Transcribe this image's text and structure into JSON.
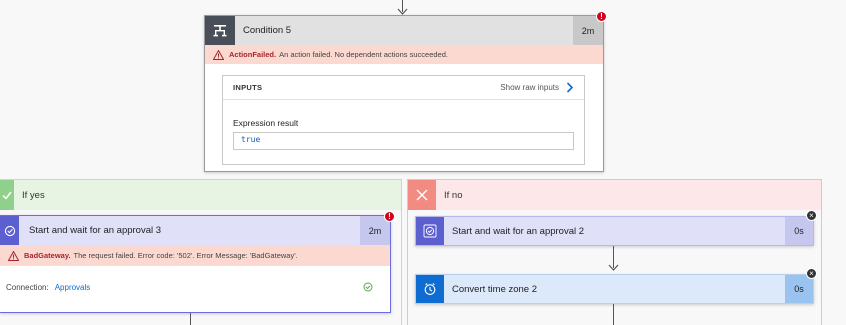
{
  "condition": {
    "title": "Condition 5",
    "duration": "2m",
    "error_code": "ActionFailed.",
    "error_message": "An action failed. No dependent actions succeeded.",
    "inputs_label": "INPUTS",
    "show_raw_label": "Show raw inputs",
    "expression_label": "Expression result",
    "expression_value": "true"
  },
  "branch_yes": {
    "label": "If yes",
    "approval": {
      "title": "Start and wait for an approval 3",
      "duration": "2m",
      "error_code": "BadGateway.",
      "error_message": "The request failed. Error code: '502'. Error Message: 'BadGateway'.",
      "connection_label": "Connection:",
      "connection_value": "Approvals"
    }
  },
  "branch_no": {
    "label": "If no",
    "approval": {
      "title": "Start and wait for an approval 2",
      "duration": "0s"
    },
    "timezone": {
      "title": "Convert time zone 2",
      "duration": "0s"
    }
  },
  "colors": {
    "condition_header": "#e1e1e1",
    "condition_icon_bg": "#484f58",
    "approval_header": "#e0e0f8",
    "approval_icon_bg": "#5c5fd0",
    "timezone_header": "#dce9fa",
    "timezone_icon_bg": "#0f6cd0",
    "yes_bg": "#e7f4e4",
    "no_bg": "#fde7e9",
    "error": "#d0021b"
  },
  "icons": [
    "arrow-down-icon",
    "condition-icon",
    "warning-icon",
    "chevron-right-icon",
    "check-icon",
    "close-icon",
    "approval-icon",
    "clock-icon",
    "check-circle-icon",
    "error-icon"
  ]
}
